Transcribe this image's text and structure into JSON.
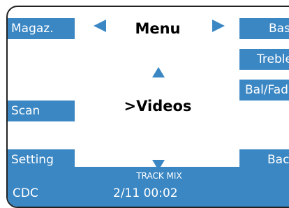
{
  "left_buttons": {
    "magazine": "Magaz.",
    "scan": "Scan",
    "setting": "Setting"
  },
  "right_buttons": {
    "bass": "Bass",
    "treble": "Treble",
    "balance_fader": "Bal/Fader",
    "back": "Back"
  },
  "menu": {
    "title": "Menu",
    "current_item": ">Videos"
  },
  "status_bar": {
    "source": "CDC",
    "track_name": "TRACK MIX",
    "track_time": "2/11  00:02"
  },
  "colors": {
    "accent": "#3b87c4",
    "background": "#ffffff",
    "text": "#000000",
    "bezel": "#222222"
  },
  "icons": {
    "prev": "triangle-left-icon",
    "next": "triangle-right-icon",
    "up": "triangle-up-icon",
    "down": "triangle-down-icon"
  }
}
